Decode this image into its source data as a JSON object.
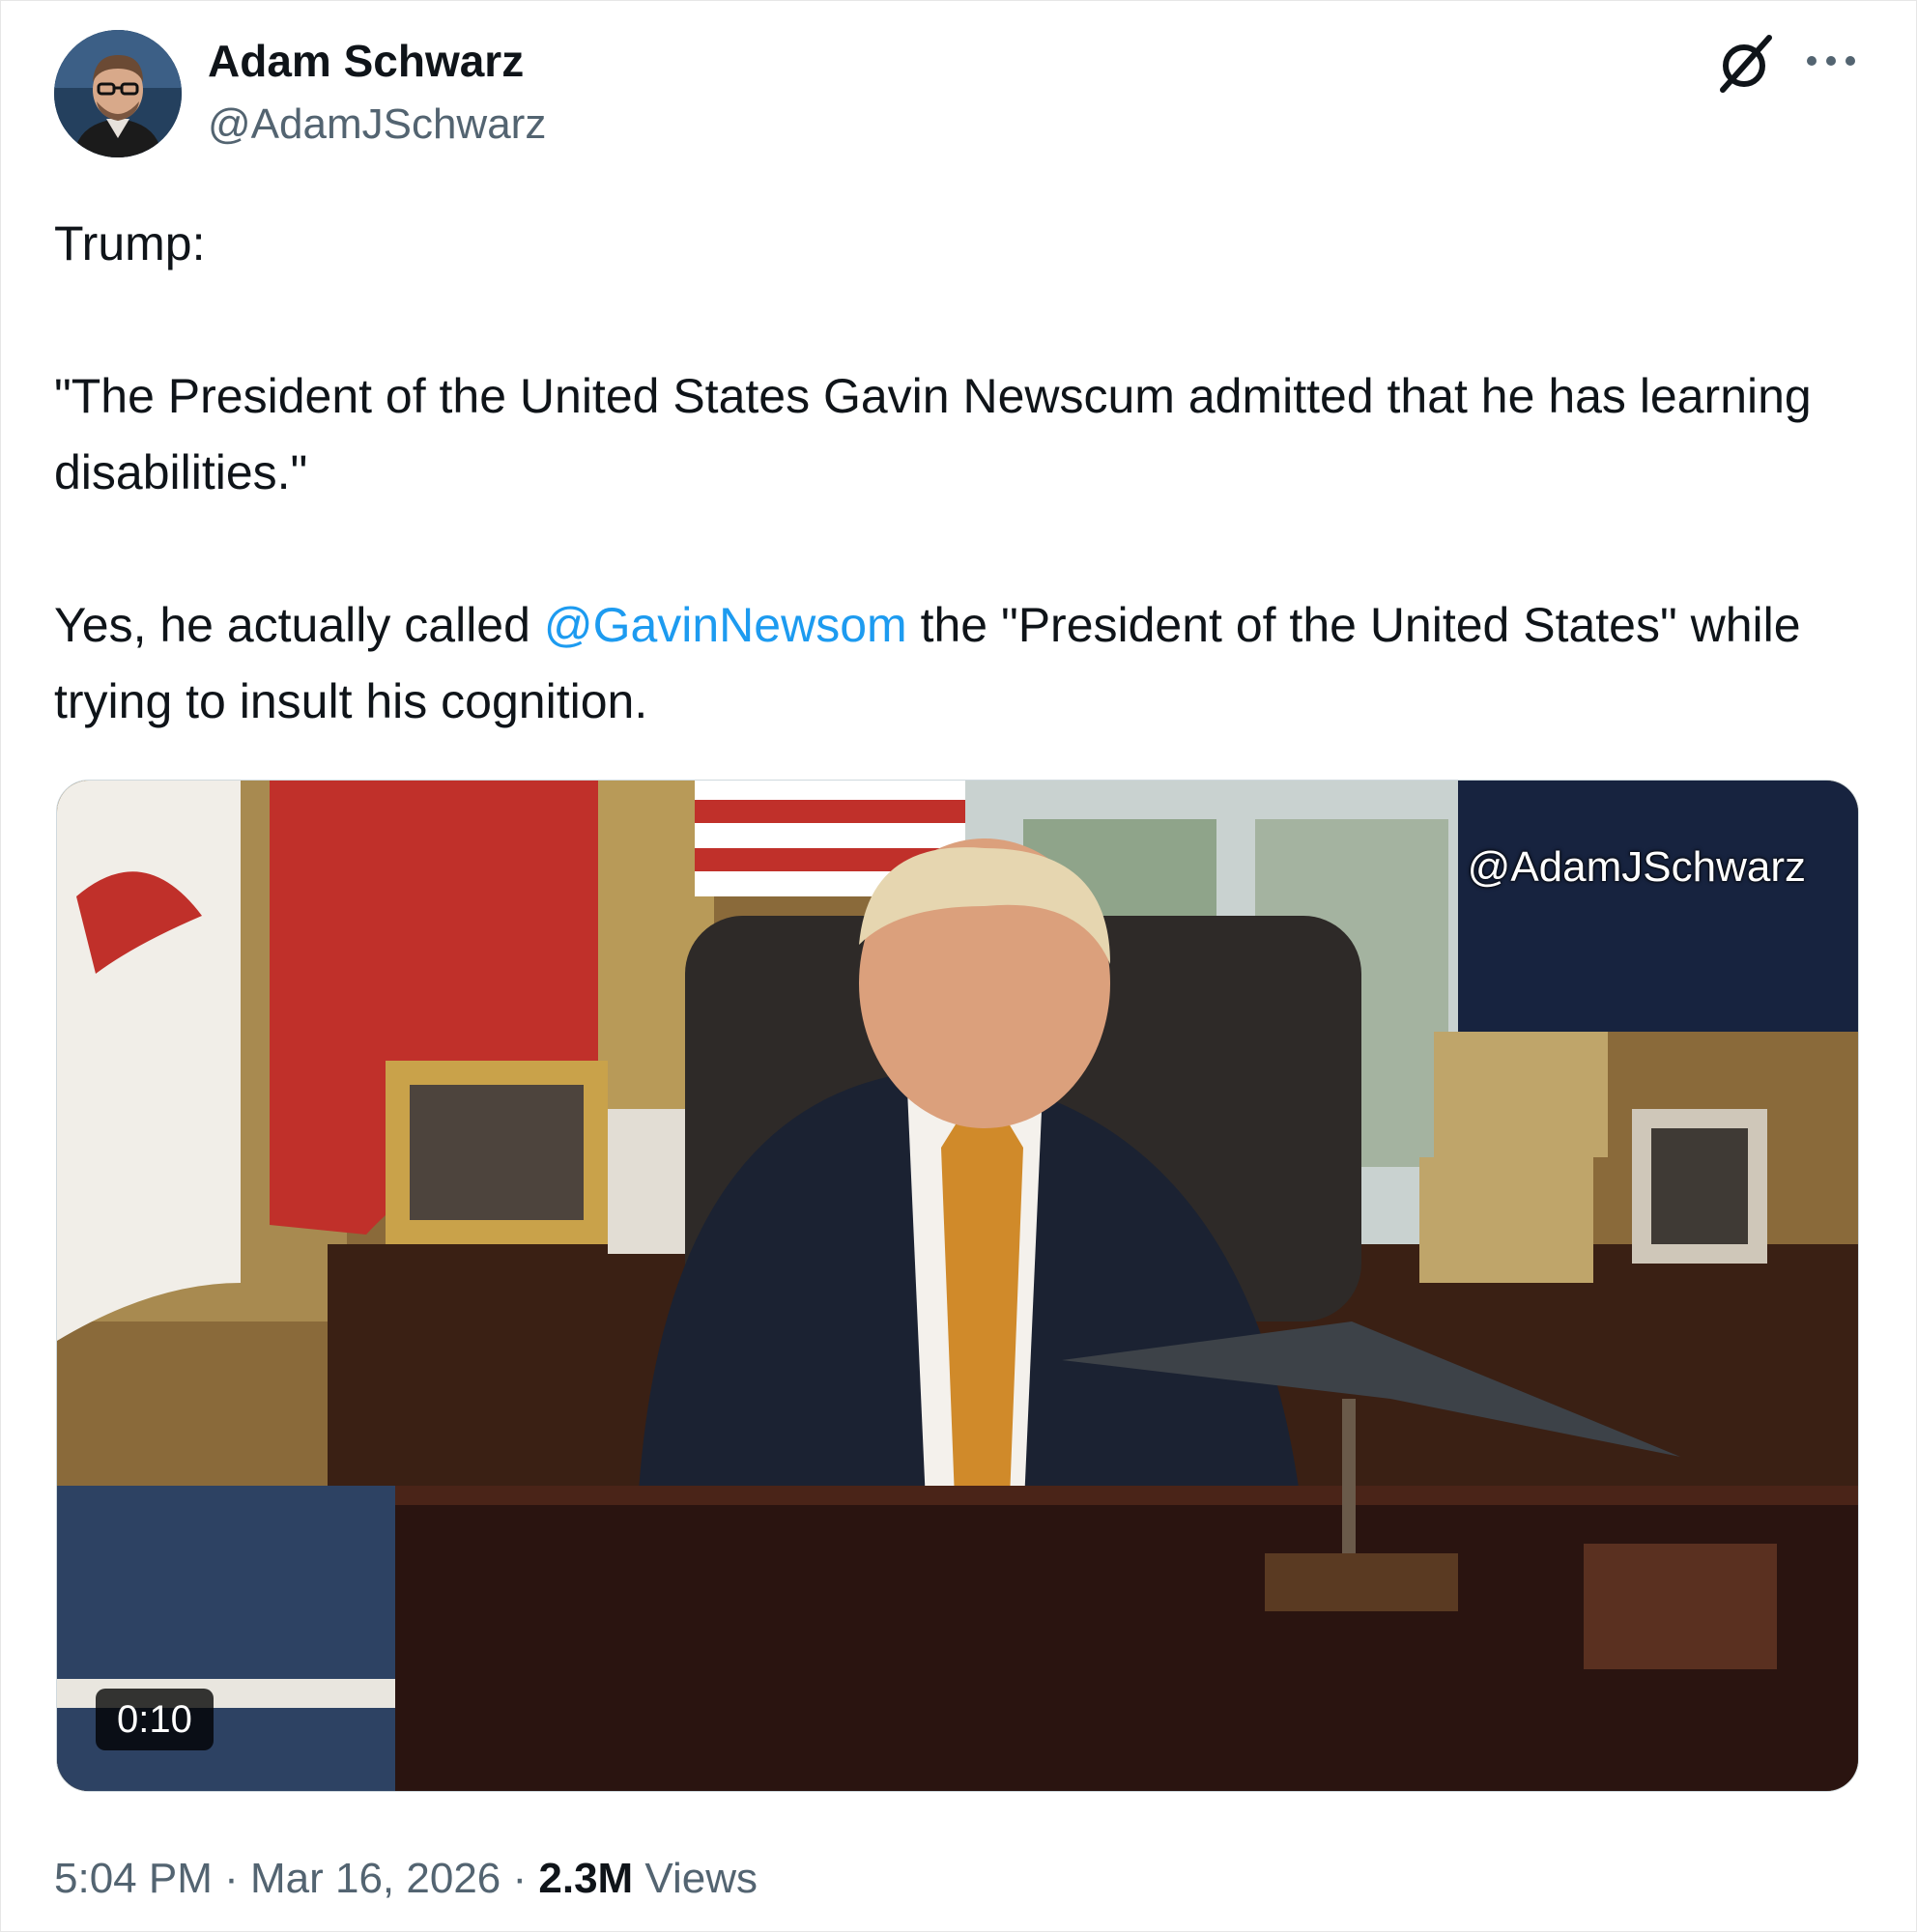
{
  "author": {
    "name": "Adam Schwarz",
    "handle": "@AdamJSchwarz"
  },
  "tweet": {
    "line1": "Trump:",
    "quote": "\"The President of the United States Gavin Newscum admitted that he has learning disabilities.\"",
    "para_before_mention": "Yes, he actually called ",
    "mention": "@GavinNewsom",
    "para_after_mention": " the \"President of the United States\" while trying to insult his cognition."
  },
  "media": {
    "watermark": "@AdamJSchwarz",
    "duration": "0:10"
  },
  "meta": {
    "time": "5:04 PM",
    "separator": " · ",
    "date": "Mar 16, 2026",
    "views_count": "2.3M",
    "views_label": " Views"
  },
  "icons": {
    "header_right": [
      "grok-icon",
      "more-icon"
    ]
  },
  "colors": {
    "mention": "#1d9bf0",
    "secondary_text": "#536471",
    "primary_text": "#0f1419"
  }
}
